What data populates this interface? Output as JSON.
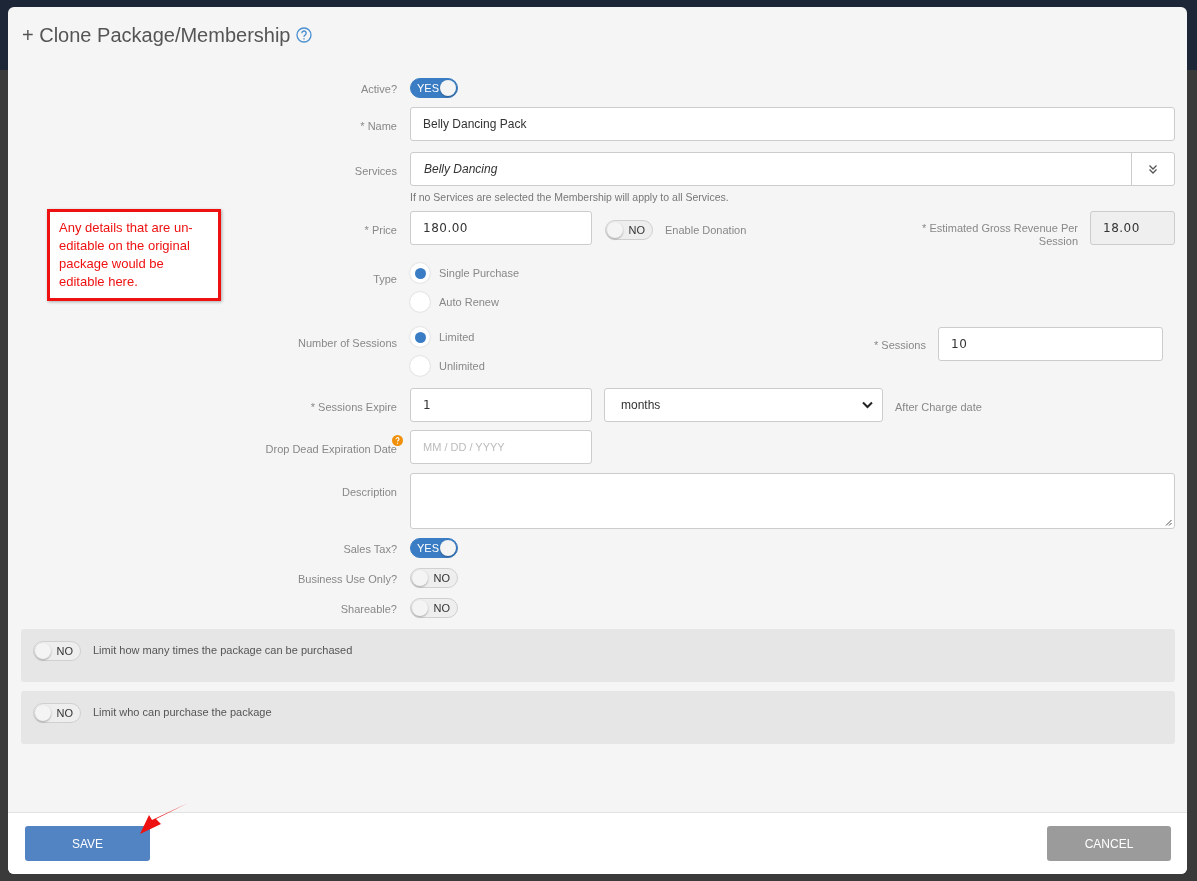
{
  "dialog": {
    "title": "+ Clone Package/Membership"
  },
  "active": {
    "label": "Active?",
    "toggle": {
      "text": "YES",
      "on": true
    }
  },
  "name": {
    "label": "* Name",
    "value": "Belly Dancing Pack"
  },
  "services": {
    "label": "Services",
    "value": "Belly Dancing",
    "hint": "If no Services are selected the Membership will apply to all Services."
  },
  "price": {
    "label": "* Price",
    "value": "180.00",
    "donation": {
      "text": "NO",
      "on": false,
      "label": "Enable Donation"
    }
  },
  "revenue": {
    "label": "* Estimated Gross Revenue Per Session",
    "value": "18.00"
  },
  "type": {
    "label": "Type",
    "options": [
      {
        "label": "Single Purchase",
        "selected": true
      },
      {
        "label": "Auto Renew",
        "selected": false
      }
    ]
  },
  "number_of_sessions": {
    "label": "Number of Sessions",
    "options": [
      {
        "label": "Limited",
        "selected": true
      },
      {
        "label": "Unlimited",
        "selected": false
      }
    ]
  },
  "sessions": {
    "label": "* Sessions",
    "value": "10"
  },
  "sessions_expire": {
    "label": "* Sessions Expire",
    "value": "1",
    "unit": "months",
    "after": "After Charge date"
  },
  "drop_dead": {
    "label": "Drop Dead Expiration Date",
    "placeholder": "MM / DD / YYYY"
  },
  "description": {
    "label": "Description"
  },
  "switches": [
    {
      "label": "Sales Tax?",
      "text": "YES",
      "on": true
    },
    {
      "label": "Business Use Only?",
      "text": "NO",
      "on": false
    },
    {
      "label": "Shareable?",
      "text": "NO",
      "on": false
    }
  ],
  "limits": [
    {
      "text": "NO",
      "on": false,
      "label": "Limit how many times the package can be purchased"
    },
    {
      "text": "NO",
      "on": false,
      "label": "Limit who can purchase the package"
    }
  ],
  "annotation": {
    "text": "Any details that are un-editable on the original package would be editable here."
  },
  "buttons": {
    "save": "SAVE",
    "cancel": "CANCEL"
  }
}
